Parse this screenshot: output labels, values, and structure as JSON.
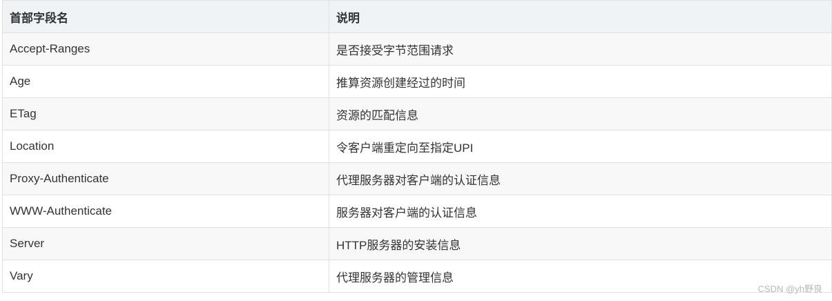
{
  "table": {
    "headers": [
      "首部字段名",
      "说明"
    ],
    "rows": [
      [
        "Accept-Ranges",
        "是否接受字节范围请求"
      ],
      [
        "Age",
        "推算资源创建经过的时间"
      ],
      [
        "ETag",
        "资源的匹配信息"
      ],
      [
        "Location",
        "令客户端重定向至指定UPI"
      ],
      [
        "Proxy-Authenticate",
        "代理服务器对客户端的认证信息"
      ],
      [
        "WWW-Authenticate",
        "服务器对客户端的认证信息"
      ],
      [
        "Server",
        "HTTP服务器的安装信息"
      ],
      [
        "Vary",
        "代理服务器的管理信息"
      ]
    ]
  },
  "watermark": "CSDN @yh野良"
}
